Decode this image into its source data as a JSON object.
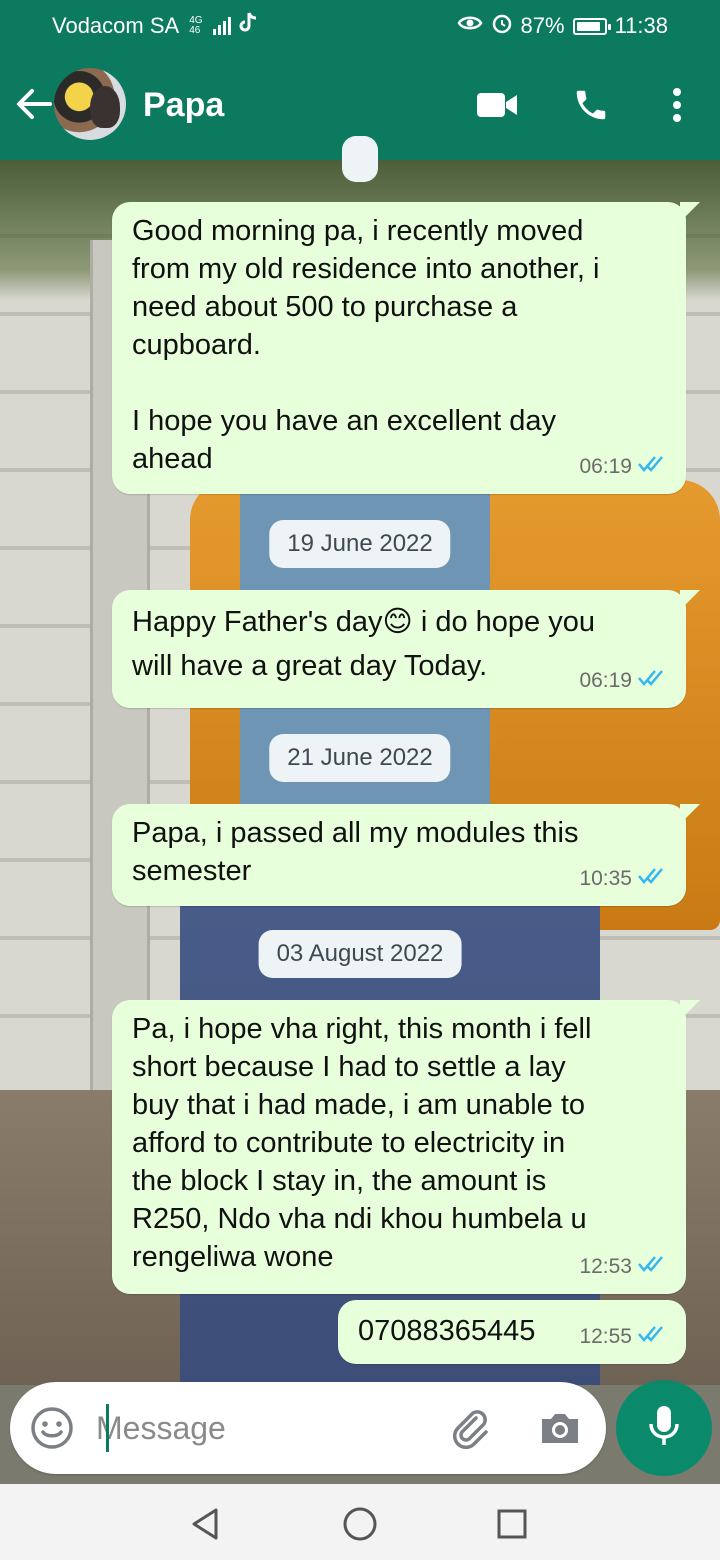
{
  "status_bar": {
    "carrier": "Vodacom SA",
    "network_type_top": "4G",
    "network_type_bottom": "46",
    "battery_percent": "87%",
    "battery_level": 0.87,
    "time": "11:38"
  },
  "header": {
    "contact_name": "Papa"
  },
  "chat": {
    "messages": [
      {
        "kind": "outgoing",
        "text": "Good morning pa, i recently moved\nfrom my old residence into another, i\nneed about 500 to purchase a\ncupboard.\n\nI hope you have an excellent day\nahead",
        "time": "06:19",
        "status": "read"
      },
      {
        "kind": "date",
        "label": "19 June 2022"
      },
      {
        "kind": "outgoing",
        "text": "Happy Father's day😊 i do hope you\nwill have a great day Today.",
        "time": "06:19",
        "status": "read"
      },
      {
        "kind": "date",
        "label": "21 June 2022"
      },
      {
        "kind": "outgoing",
        "text": "Papa, i passed all my modules this\nsemester",
        "time": "10:35",
        "status": "read"
      },
      {
        "kind": "date",
        "label": "03 August 2022"
      },
      {
        "kind": "outgoing",
        "text": "Pa, i hope vha right, this month i fell\nshort because I had to settle a lay\nbuy that i had made, i am unable to\nafford to contribute to electricity in\nthe block I stay in, the amount is\nR250, Ndo vha ndi khou humbela u\nrengeliwa wone",
        "time": "12:53",
        "status": "read"
      },
      {
        "kind": "outgoing",
        "text": "07088365445",
        "time": "12:55",
        "status": "read"
      }
    ]
  },
  "composer": {
    "placeholder": "Message"
  },
  "colors": {
    "brand": "#0b7a5e",
    "bubble_out": "#e7ffdb",
    "read_tick": "#34b7f1"
  },
  "icons": {
    "header": [
      "back-arrow-icon",
      "video-call-icon",
      "phone-icon",
      "more-vert-icon"
    ],
    "composer": [
      "emoji-icon",
      "attach-icon",
      "camera-icon",
      "mic-icon"
    ],
    "nav": [
      "back-triangle-icon",
      "home-circle-icon",
      "recents-square-icon"
    ]
  }
}
